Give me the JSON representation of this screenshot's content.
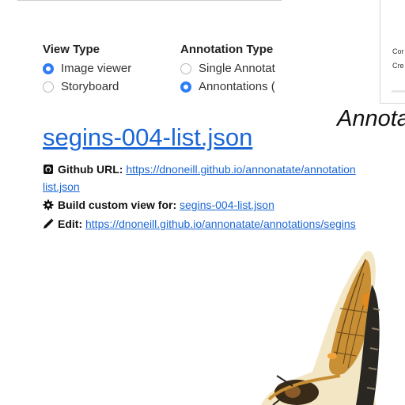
{
  "side_panel": {
    "line1": "Cor",
    "line2": "Cre"
  },
  "view_type": {
    "title": "View Type",
    "options": [
      {
        "label": "Image viewer",
        "checked": true
      },
      {
        "label": "Storyboard",
        "checked": false
      }
    ]
  },
  "annotation_type": {
    "title": "Annotation Type",
    "options": [
      {
        "label": "Single Annotat",
        "checked": false
      },
      {
        "label": "Annontations (",
        "checked": true
      }
    ]
  },
  "annotations_heading": "Annota",
  "file_title": "segins-004-list.json",
  "github": {
    "label": "Github URL:",
    "url_part1": "https://dnoneill.github.io/annonatate/annotation",
    "url_part2": "list.json"
  },
  "build": {
    "label": "Build custom view for:",
    "link": "segins-004-list.json"
  },
  "edit": {
    "label": "Edit:",
    "link": "https://dnoneill.github.io/annonatate/annotations/segins"
  },
  "icons": {
    "github": "github-icon",
    "build": "gear-icon",
    "edit": "pencil-icon"
  },
  "colors": {
    "link": "#1a66d6",
    "radio_checked": "#2f7cf6"
  }
}
